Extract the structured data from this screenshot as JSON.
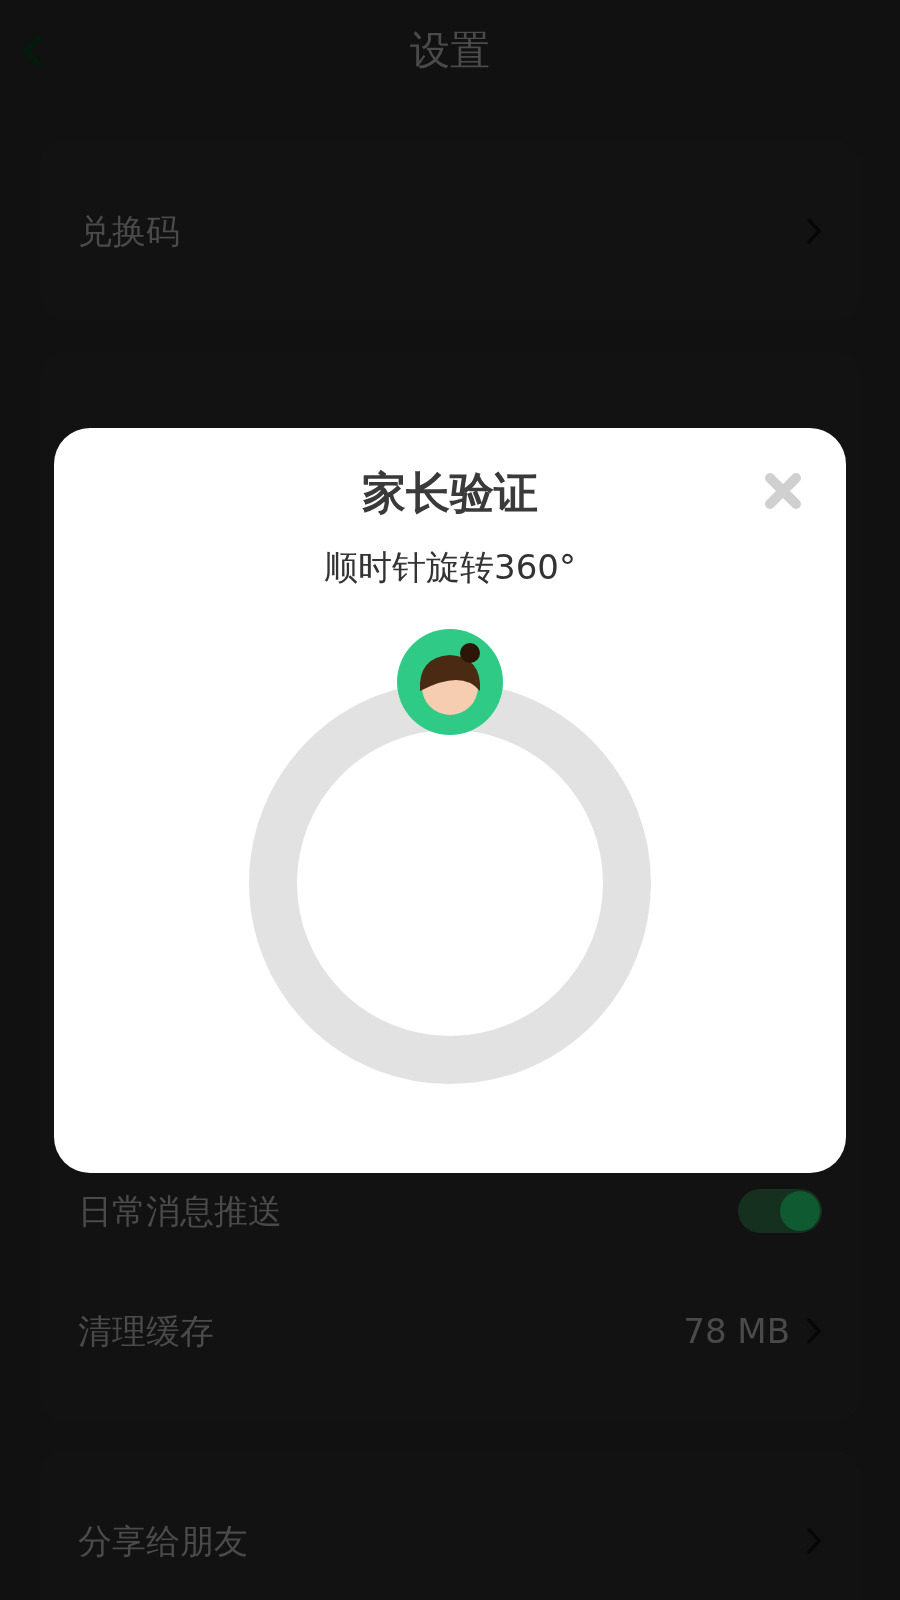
{
  "header": {
    "title": "设置"
  },
  "sections": [
    {
      "rows": [
        {
          "kind": "link",
          "label": "兑换码"
        }
      ]
    },
    {
      "rows": [
        {
          "kind": "toggle",
          "label": "日常消息推送",
          "on": true
        },
        {
          "kind": "link",
          "label": "清理缓存",
          "value": "78 MB"
        }
      ]
    },
    {
      "rows": [
        {
          "kind": "link",
          "label": "分享给朋友"
        }
      ]
    }
  ],
  "dialog": {
    "title": "家长验证",
    "instruction": "顺时针旋转360°"
  }
}
